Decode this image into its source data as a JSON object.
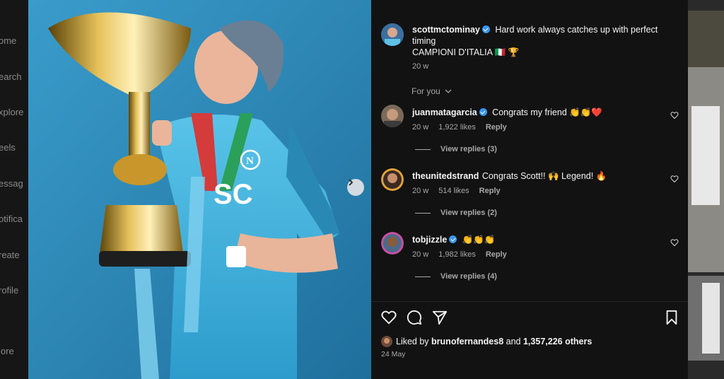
{
  "nav": {
    "items": [
      "ome",
      "earch",
      "xplore",
      "eels",
      "essag",
      "otifica",
      "reate",
      "rofile",
      "lore"
    ]
  },
  "photo": {
    "jersey_text": "SC"
  },
  "post": {
    "author": "scottmctominay",
    "caption_line1": "Hard work always catches up with perfect",
    "caption_line2": "timing",
    "caption_line3": "CAMPIONI D'ITALIA 🇮🇹 🏆",
    "time": "20 w"
  },
  "for_you_label": "For you",
  "comments": [
    {
      "user": "juanmatagarcia",
      "text": "Congrats my friend 👏👏❤️",
      "time": "20 w",
      "likes": "1,922 likes",
      "reply": "Reply",
      "view_replies": "View replies (3)"
    },
    {
      "user": "theunitedstrand",
      "text": "Congrats Scott!! 🙌 Legend! 🔥",
      "time": "20 w",
      "likes": "514 likes",
      "reply": "Reply",
      "view_replies": "View replies (2)"
    },
    {
      "user": "tobjizzle",
      "text": "👏👏👏",
      "time": "20 w",
      "likes": "1,982 likes",
      "reply": "Reply",
      "view_replies": "View replies (4)"
    }
  ],
  "likes": {
    "prefix": "Liked by",
    "user": "brunofernandes8",
    "mid": "and",
    "others": "1,357,226 others"
  },
  "date": "24 May",
  "colors": {
    "background": "#121212",
    "photo_bg": "#2f8dbf",
    "verified": "#3897f0",
    "muted": "#a8a8a8"
  }
}
